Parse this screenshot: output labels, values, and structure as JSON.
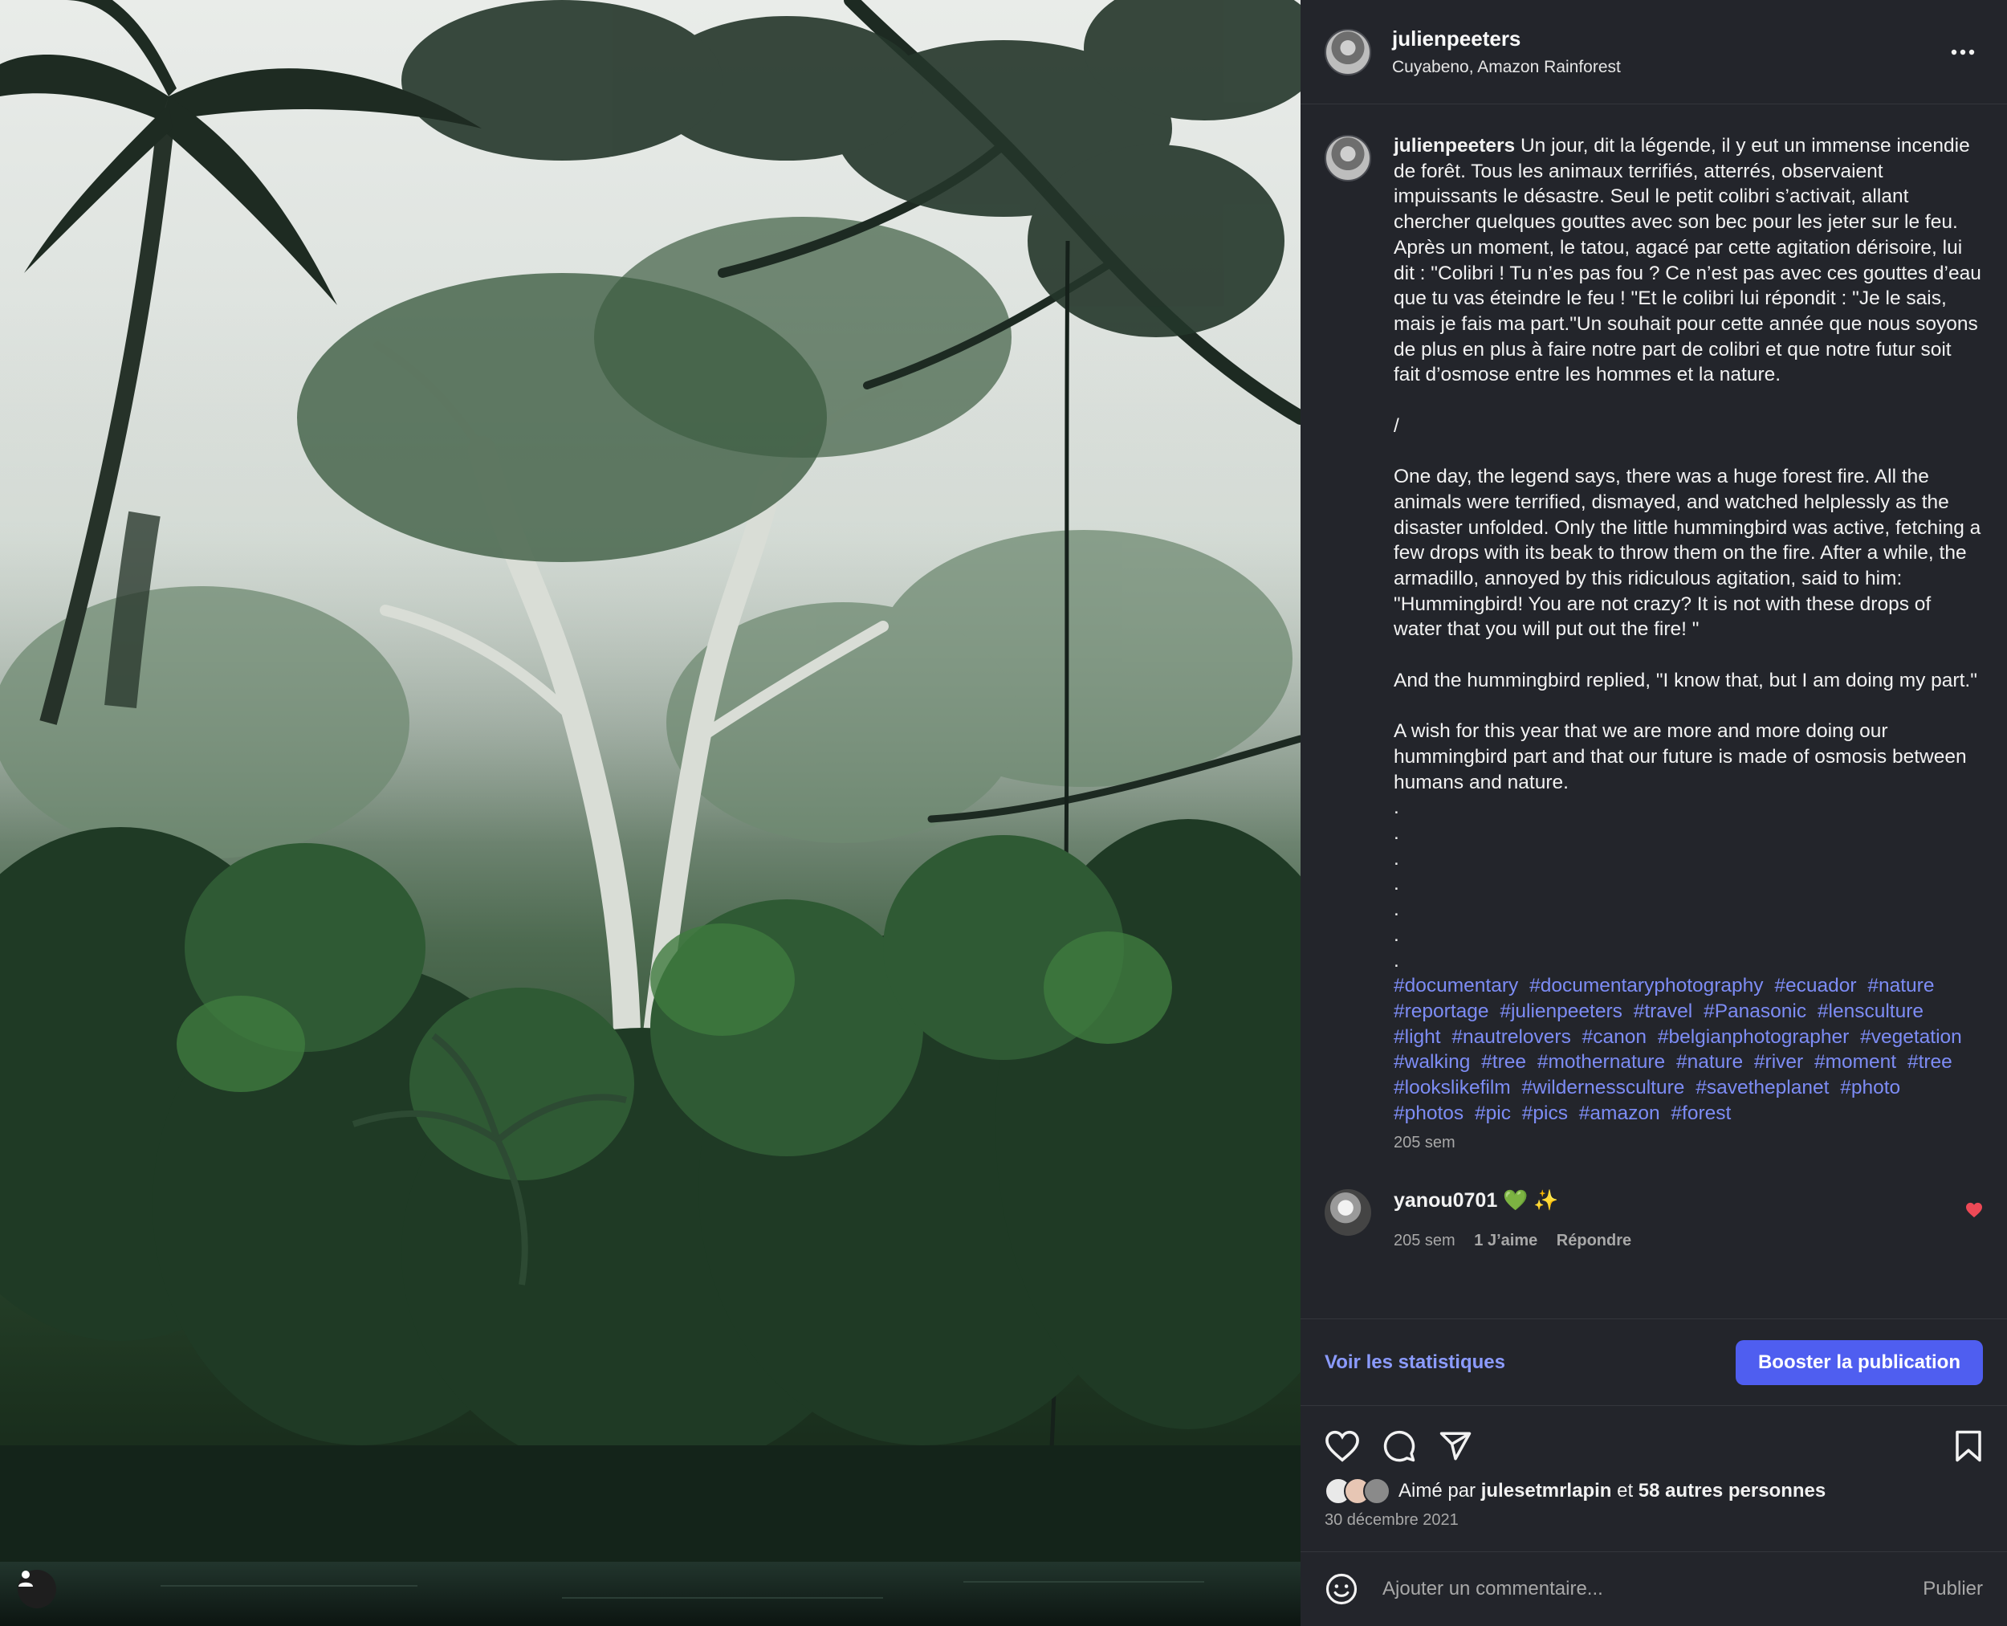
{
  "post": {
    "username": "julienpeeters",
    "location": "Cuyabeno, Amazon Rainforest",
    "more_icon": "more-horizontal-icon"
  },
  "caption": {
    "username": "julienpeeters",
    "text": " Un jour, dit la légende, il y eut un immense incendie de forêt. Tous les animaux terrifiés, atterrés, observaient impuissants le désastre. Seul le petit colibri s’activait, allant chercher quelques gouttes avec son bec pour les jeter sur le feu. Après un moment, le tatou, agacé par cette agitation dérisoire, lui dit : \"Colibri ! Tu n’es pas fou ? Ce n’est pas avec ces gouttes d’eau que tu vas éteindre le feu ! \"Et le colibri lui répondit : \"Je le sais, mais je fais ma part.\"Un souhait pour cette année que nous soyons de plus en plus à faire notre part de colibri et que notre futur soit fait d’osmose entre les hommes et la nature.\n\n/\n\nOne day, the legend says, there was a huge forest fire. All the animals were terrified, dismayed, and watched helplessly as the disaster unfolded. Only the little hummingbird was active, fetching a few drops with its beak to throw them on the fire. After a while, the armadillo, annoyed by this ridiculous agitation, said to him: \"Hummingbird! You are not crazy? It is not with these drops of water that you will put out the fire! \"\n\nAnd the hummingbird replied, \"I know that, but I am doing my part.\"\n\nA wish for this year that we are more and more doing our hummingbird part and that our future is made of osmosis between humans and nature.\n.\n.\n.\n.\n.\n.\n.",
    "hashtags": [
      "#documentary",
      "#documentaryphotography",
      "#ecuador",
      "#nature",
      "#reportage",
      "#julienpeeters",
      "#travel",
      "#Panasonic",
      "#lensculture",
      "#light",
      "#nautrelovers",
      "#canon",
      "#belgianphotographer",
      "#vegetation",
      "#walking",
      "#tree",
      "#mothernature",
      "#nature",
      "#river",
      "#moment",
      "#tree",
      "#lookslikefilm",
      "#wildernessculture",
      "#savetheplanet",
      "#photo",
      "#photos",
      "#pic",
      "#pics",
      "#amazon",
      "#forest"
    ],
    "time": "205 sem"
  },
  "comment": {
    "username": "yanou0701",
    "text": "💚 ✨",
    "time": "205 sem",
    "likes": "1 J’aime",
    "reply": "Répondre",
    "heart_color": "#ed4956"
  },
  "actions": {
    "stats_link": "Voir les statistiques",
    "boost_button": "Booster la publication"
  },
  "likes": {
    "prefix": "Aimé par",
    "user": "julesetmrlapin",
    "conjunction": "et",
    "others": "58 autres personnes",
    "mini_avatar_label": "JulesMrLapin"
  },
  "date": "30 décembre 2021",
  "comment_box": {
    "placeholder": "Ajouter un commentaire...",
    "publish": "Publier"
  },
  "colors": {
    "panel_bg": "#23252b",
    "accent": "#4f5ef0",
    "hashtag": "#7d8cf5",
    "link": "#8b9bff"
  }
}
